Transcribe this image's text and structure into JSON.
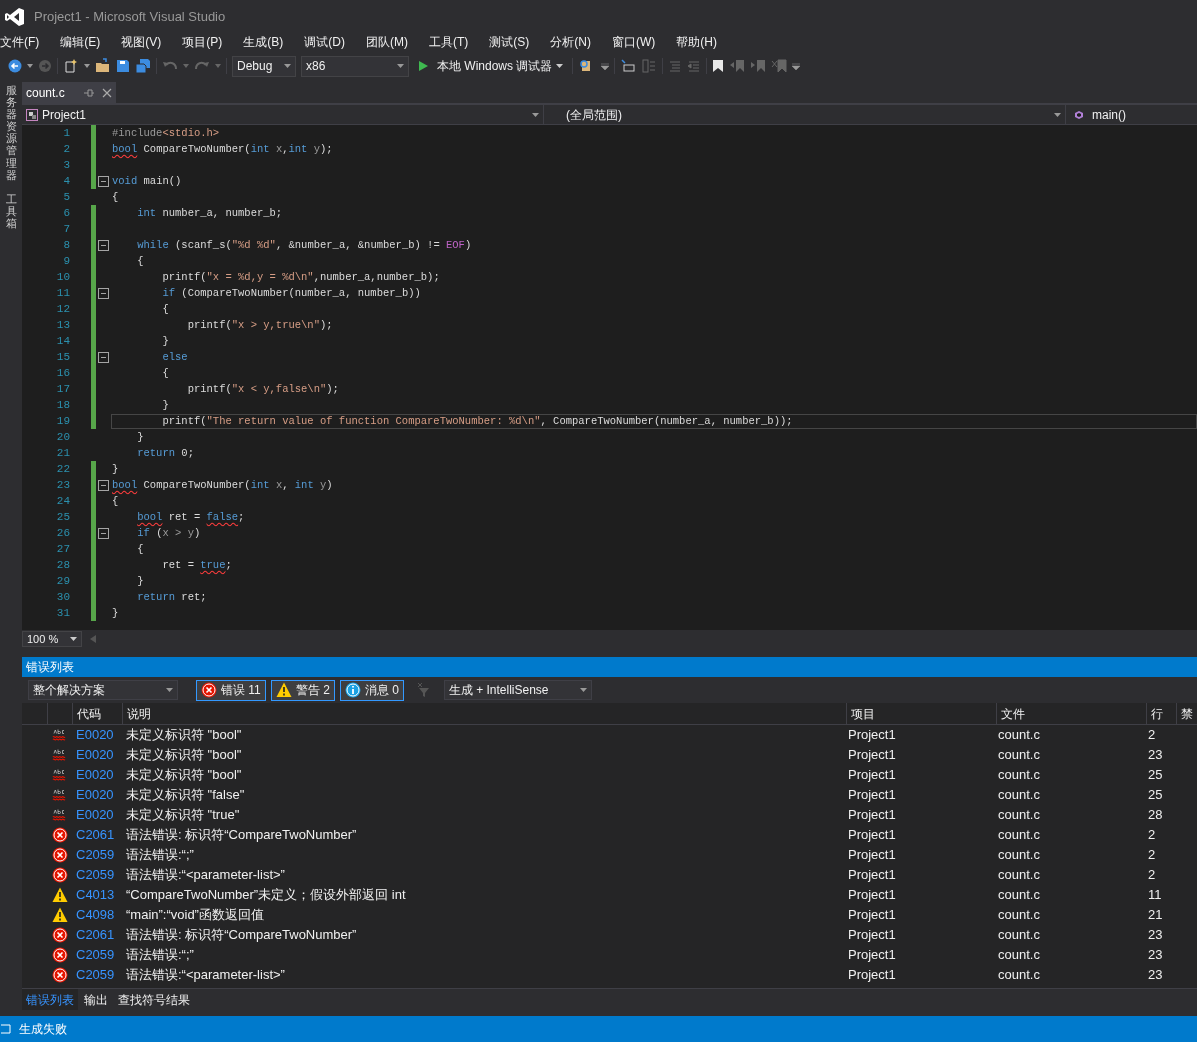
{
  "title_bar": {
    "title": "Project1 - Microsoft Visual Studio"
  },
  "menu": [
    "文件(F)",
    "编辑(E)",
    "视图(V)",
    "项目(P)",
    "生成(B)",
    "调试(D)",
    "团队(M)",
    "工具(T)",
    "测试(S)",
    "分析(N)",
    "窗口(W)",
    "帮助(H)"
  ],
  "toolbar": {
    "configuration": "Debug",
    "platform": "x86",
    "debug_target": "本地 Windows 调试器"
  },
  "side_panels": [
    "服务器资源管理器",
    "工具箱"
  ],
  "document_tabs": [
    {
      "label": "count.c",
      "selected": true
    }
  ],
  "navigation_bar": {
    "project": "Project1",
    "scope": "(全局范围)",
    "member": "main()"
  },
  "editor": {
    "zoom": "100 %",
    "lines": [
      {
        "n": "1",
        "changed": true,
        "fold": false,
        "current": false,
        "tokens": [
          {
            "kind": "pre",
            "text": "#include"
          },
          {
            "kind": "str",
            "text": "<stdio.h>"
          }
        ]
      },
      {
        "n": "2",
        "changed": true,
        "fold": false,
        "current": false,
        "tokens": [
          {
            "kind": "kwerr",
            "text": "bool"
          },
          {
            "kind": "txt",
            "text": " CompareTwoNumber("
          },
          {
            "kind": "kw",
            "text": "int"
          },
          {
            "kind": "param",
            "text": " x"
          },
          {
            "kind": "txt",
            "text": ","
          },
          {
            "kind": "kw",
            "text": "int"
          },
          {
            "kind": "param",
            "text": " y"
          },
          {
            "kind": "txt",
            "text": ");"
          }
        ]
      },
      {
        "n": "3",
        "changed": true,
        "fold": false,
        "current": false
      },
      {
        "n": "4",
        "changed": true,
        "fold": true,
        "current": false,
        "tokens": [
          {
            "kind": "kw",
            "text": "void"
          },
          {
            "kind": "txt",
            "text": " main()"
          }
        ]
      },
      {
        "n": "5",
        "changed": false,
        "fold": false,
        "current": false,
        "tokens": [
          {
            "kind": "txt",
            "text": "{"
          }
        ]
      },
      {
        "n": "6",
        "changed": true,
        "fold": false,
        "current": false,
        "tokens": [
          {
            "kind": "kw",
            "text": "    int"
          },
          {
            "kind": "txt",
            "text": " number_a, number_b;"
          }
        ]
      },
      {
        "n": "7",
        "changed": true,
        "fold": false,
        "current": false
      },
      {
        "n": "8",
        "changed": true,
        "fold": true,
        "current": false,
        "tokens": [
          {
            "kind": "kw",
            "text": "    while"
          },
          {
            "kind": "txt",
            "text": " (scanf_s("
          },
          {
            "kind": "str",
            "text": "\"%d %d\""
          },
          {
            "kind": "txt",
            "text": ", &number_a, &number_b) != "
          },
          {
            "kind": "macro",
            "text": "EOF"
          },
          {
            "kind": "txt",
            "text": ")"
          }
        ]
      },
      {
        "n": "9",
        "changed": true,
        "fold": false,
        "current": false,
        "tokens": [
          {
            "kind": "txt",
            "text": "    {"
          }
        ]
      },
      {
        "n": "10",
        "changed": true,
        "fold": false,
        "current": false,
        "tokens": [
          {
            "kind": "txt",
            "text": "        printf("
          },
          {
            "kind": "str",
            "text": "\"x = %d,y = %d\\n\""
          },
          {
            "kind": "txt",
            "text": ",number_a,number_b);"
          }
        ]
      },
      {
        "n": "11",
        "changed": true,
        "fold": true,
        "current": false,
        "tokens": [
          {
            "kind": "kw",
            "text": "        if"
          },
          {
            "kind": "txt",
            "text": " (CompareTwoNumber(number_a, number_b))"
          }
        ]
      },
      {
        "n": "12",
        "changed": true,
        "fold": false,
        "current": false,
        "tokens": [
          {
            "kind": "txt",
            "text": "        {"
          }
        ]
      },
      {
        "n": "13",
        "changed": true,
        "fold": false,
        "current": false,
        "tokens": [
          {
            "kind": "txt",
            "text": "            printf("
          },
          {
            "kind": "str",
            "text": "\"x > y,true\\n\""
          },
          {
            "kind": "txt",
            "text": ");"
          }
        ]
      },
      {
        "n": "14",
        "changed": true,
        "fold": false,
        "current": false,
        "tokens": [
          {
            "kind": "txt",
            "text": "        }"
          }
        ]
      },
      {
        "n": "15",
        "changed": true,
        "fold": true,
        "current": false,
        "tokens": [
          {
            "kind": "kw",
            "text": "        else"
          }
        ]
      },
      {
        "n": "16",
        "changed": true,
        "fold": false,
        "current": false,
        "tokens": [
          {
            "kind": "txt",
            "text": "        {"
          }
        ]
      },
      {
        "n": "17",
        "changed": true,
        "fold": false,
        "current": false,
        "tokens": [
          {
            "kind": "txt",
            "text": "            printf("
          },
          {
            "kind": "str",
            "text": "\"x < y,false\\n\""
          },
          {
            "kind": "txt",
            "text": ");"
          }
        ]
      },
      {
        "n": "18",
        "changed": true,
        "fold": false,
        "current": false,
        "tokens": [
          {
            "kind": "txt",
            "text": "        }"
          }
        ]
      },
      {
        "n": "19",
        "changed": true,
        "fold": false,
        "current": true,
        "tokens": [
          {
            "kind": "txt",
            "text": "        printf("
          },
          {
            "kind": "str",
            "text": "\"The return value of function CompareTwoNumber: %d\\n\""
          },
          {
            "kind": "txt",
            "text": ", CompareTwoNumber(number_a, number_b));"
          }
        ]
      },
      {
        "n": "20",
        "changed": false,
        "fold": false,
        "current": false,
        "tokens": [
          {
            "kind": "txt",
            "text": "    }"
          }
        ]
      },
      {
        "n": "21",
        "changed": false,
        "fold": false,
        "current": false,
        "tokens": [
          {
            "kind": "kw",
            "text": "    return"
          },
          {
            "kind": "txt",
            "text": " 0;"
          }
        ]
      },
      {
        "n": "22",
        "changed": true,
        "fold": false,
        "current": false,
        "tokens": [
          {
            "kind": "txt",
            "text": "}"
          }
        ]
      },
      {
        "n": "23",
        "changed": true,
        "fold": true,
        "current": false,
        "tokens": [
          {
            "kind": "kwerr",
            "text": "bool"
          },
          {
            "kind": "txt",
            "text": " CompareTwoNumber("
          },
          {
            "kind": "kw",
            "text": "int"
          },
          {
            "kind": "param",
            "text": " x"
          },
          {
            "kind": "txt",
            "text": ", "
          },
          {
            "kind": "kw",
            "text": "int"
          },
          {
            "kind": "param",
            "text": " y"
          },
          {
            "kind": "txt",
            "text": ")"
          }
        ]
      },
      {
        "n": "24",
        "changed": true,
        "fold": false,
        "current": false,
        "tokens": [
          {
            "kind": "txt",
            "text": "{"
          }
        ]
      },
      {
        "n": "25",
        "changed": true,
        "fold": false,
        "current": false,
        "tokens": [
          {
            "kind": "kwerr",
            "text": "    bool"
          },
          {
            "kind": "txt",
            "text": " ret = "
          },
          {
            "kind": "kwerr",
            "text": "false"
          },
          {
            "kind": "txt",
            "text": ";"
          }
        ]
      },
      {
        "n": "26",
        "changed": true,
        "fold": true,
        "current": false,
        "tokens": [
          {
            "kind": "kw",
            "text": "    if"
          },
          {
            "kind": "txt",
            "text": " ("
          },
          {
            "kind": "param",
            "text": "x > y"
          },
          {
            "kind": "txt",
            "text": ")"
          }
        ]
      },
      {
        "n": "27",
        "changed": true,
        "fold": false,
        "current": false,
        "tokens": [
          {
            "kind": "txt",
            "text": "    {"
          }
        ]
      },
      {
        "n": "28",
        "changed": true,
        "fold": false,
        "current": false,
        "tokens": [
          {
            "kind": "txt",
            "text": "        ret = "
          },
          {
            "kind": "kwerr",
            "text": "true"
          },
          {
            "kind": "txt",
            "text": ";"
          }
        ]
      },
      {
        "n": "29",
        "changed": true,
        "fold": false,
        "current": false,
        "tokens": [
          {
            "kind": "txt",
            "text": "    }"
          }
        ]
      },
      {
        "n": "30",
        "changed": true,
        "fold": false,
        "current": false,
        "tokens": [
          {
            "kind": "kw",
            "text": "    return"
          },
          {
            "kind": "txt",
            "text": " ret;"
          }
        ]
      },
      {
        "n": "31",
        "changed": true,
        "fold": false,
        "current": false,
        "tokens": [
          {
            "kind": "txt",
            "text": "}"
          }
        ]
      }
    ]
  },
  "error_list": {
    "title": "错误列表",
    "scope": "整个解决方案",
    "filters": [
      {
        "kind": "error",
        "label": "错误 11",
        "selected": true
      },
      {
        "kind": "warning",
        "label": "警告 2",
        "selected": true
      },
      {
        "kind": "info",
        "label": "消息 0",
        "selected": true
      }
    ],
    "source": "生成 + IntelliSense",
    "columns": [
      "代码",
      "说明",
      "项目",
      "文件",
      "行",
      "禁"
    ],
    "rows": [
      {
        "kind": "intellisense",
        "code": "E0020",
        "description": "未定义标识符 \"bool\"",
        "project": "Project1",
        "file": "count.c",
        "line": "2"
      },
      {
        "kind": "intellisense",
        "code": "E0020",
        "description": "未定义标识符 \"bool\"",
        "project": "Project1",
        "file": "count.c",
        "line": "23"
      },
      {
        "kind": "intellisense",
        "code": "E0020",
        "description": "未定义标识符 \"bool\"",
        "project": "Project1",
        "file": "count.c",
        "line": "25"
      },
      {
        "kind": "intellisense",
        "code": "E0020",
        "description": "未定义标识符 \"false\"",
        "project": "Project1",
        "file": "count.c",
        "line": "25"
      },
      {
        "kind": "intellisense",
        "code": "E0020",
        "description": "未定义标识符 \"true\"",
        "project": "Project1",
        "file": "count.c",
        "line": "28"
      },
      {
        "kind": "error",
        "code": "C2061",
        "description": "语法错误: 标识符“CompareTwoNumber”",
        "project": "Project1",
        "file": "count.c",
        "line": "2"
      },
      {
        "kind": "error",
        "code": "C2059",
        "description": "语法错误:“;”",
        "project": "Project1",
        "file": "count.c",
        "line": "2"
      },
      {
        "kind": "error",
        "code": "C2059",
        "description": "语法错误:“<parameter-list>”",
        "project": "Project1",
        "file": "count.c",
        "line": "2"
      },
      {
        "kind": "warning",
        "code": "C4013",
        "description": "“CompareTwoNumber”未定义；假设外部返回 int",
        "project": "Project1",
        "file": "count.c",
        "line": "11"
      },
      {
        "kind": "warning",
        "code": "C4098",
        "description": "“main”:“void”函数返回值",
        "project": "Project1",
        "file": "count.c",
        "line": "21"
      },
      {
        "kind": "error",
        "code": "C2061",
        "description": "语法错误: 标识符“CompareTwoNumber”",
        "project": "Project1",
        "file": "count.c",
        "line": "23"
      },
      {
        "kind": "error",
        "code": "C2059",
        "description": "语法错误:“;”",
        "project": "Project1",
        "file": "count.c",
        "line": "23"
      },
      {
        "kind": "error",
        "code": "C2059",
        "description": "语法错误:“<parameter-list>”",
        "project": "Project1",
        "file": "count.c",
        "line": "23"
      }
    ],
    "tabs": [
      {
        "label": "错误列表",
        "selected": true
      },
      {
        "label": "输出",
        "selected": false
      },
      {
        "label": "查找符号结果",
        "selected": false
      }
    ]
  },
  "status_bar": {
    "text": "生成失败"
  }
}
